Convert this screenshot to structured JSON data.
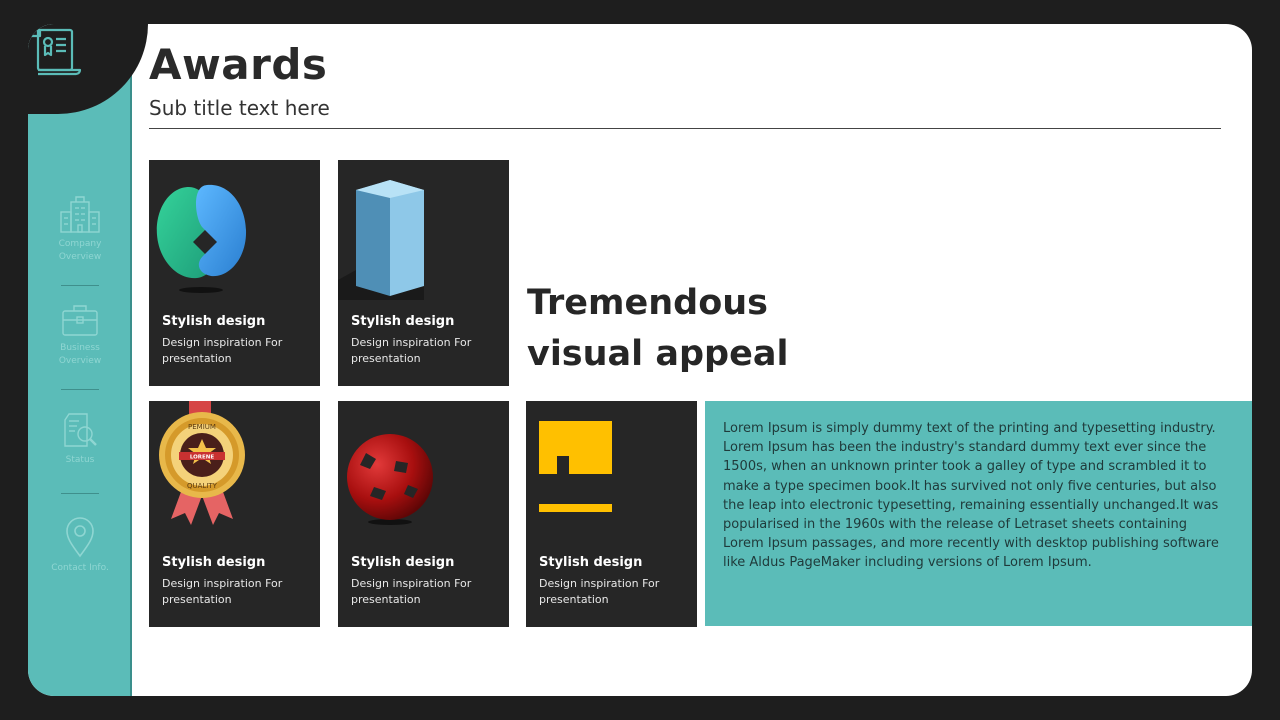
{
  "header": {
    "title": "Awards",
    "subtitle": "Sub title text here"
  },
  "sidebar": {
    "logo_icon": "certificate-scroll-icon",
    "items": [
      {
        "label": "Company\nOverview",
        "icon": "building-icon"
      },
      {
        "label": "Business\nOverview",
        "icon": "briefcase-icon"
      },
      {
        "label": "Status",
        "icon": "document-search-icon"
      },
      {
        "label": "Contact Info.",
        "icon": "location-pin-icon"
      }
    ]
  },
  "cards": [
    {
      "title": "Stylish design",
      "description": "Design inspiration For presentation",
      "icon": "gradient-loop-logo-icon"
    },
    {
      "title": "Stylish design",
      "description": "Design inspiration For presentation",
      "icon": "blue-block-icon"
    },
    {
      "title": "Stylish design",
      "description": "Design inspiration For presentation",
      "icon": "premium-quality-medal-icon"
    },
    {
      "title": "Stylish design",
      "description": "Design inspiration For presentation",
      "icon": "red-sphere-icon"
    },
    {
      "title": "Stylish design",
      "description": "Design inspiration For presentation",
      "icon": "yellow-g-logo-icon"
    }
  ],
  "medal": {
    "top_text": "PEMIUM",
    "ribbon_text": "LORENE",
    "bottom_text": "QUALITY"
  },
  "headline": "Tremendous visual appeal",
  "body_text": "Lorem Ipsum is simply dummy text of the printing and typesetting industry. Lorem Ipsum has been the industry's standard dummy text ever since the 1500s, when an unknown printer took a galley of type and scrambled it to make a type specimen book.It has survived not only five centuries, but also the leap into electronic typesetting, remaining essentially unchanged.It was popularised in the 1960s with the release of Letraset sheets containing Lorem Ipsum passages, and more recently with desktop publishing software like Aldus PageMaker including versions of Lorem Ipsum.",
  "colors": {
    "accent": "#5bbcb8",
    "card_bg": "#262626",
    "page_bg": "#1e1e1e",
    "yellow": "#ffc000",
    "red": "#b01515"
  }
}
